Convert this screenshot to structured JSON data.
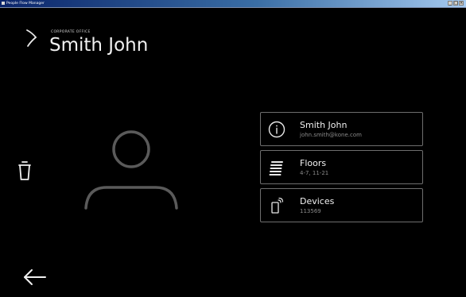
{
  "window": {
    "title": "People Flow Manager",
    "controls": [
      "_",
      "□",
      "×"
    ]
  },
  "header": {
    "eyebrow": "CORPORATE OFFICE",
    "title": "Smith John",
    "logo_icon": "kone-mark-icon"
  },
  "cards": [
    {
      "icon": "info-icon",
      "title": "Smith John",
      "subtitle": "john.smith@kone.com"
    },
    {
      "icon": "floors-icon",
      "title": "Floors",
      "subtitle": "4-7, 11-21"
    },
    {
      "icon": "device-icon",
      "title": "Devices",
      "subtitle": "113569"
    }
  ],
  "actions": {
    "delete_icon": "trash-icon",
    "back_icon": "back-arrow-icon"
  },
  "avatar_icon": "person-icon",
  "colors": {
    "background": "#000000",
    "text": "#f0f0f0",
    "muted": "#8a8a8a",
    "card_border": "#6e6e6e"
  }
}
